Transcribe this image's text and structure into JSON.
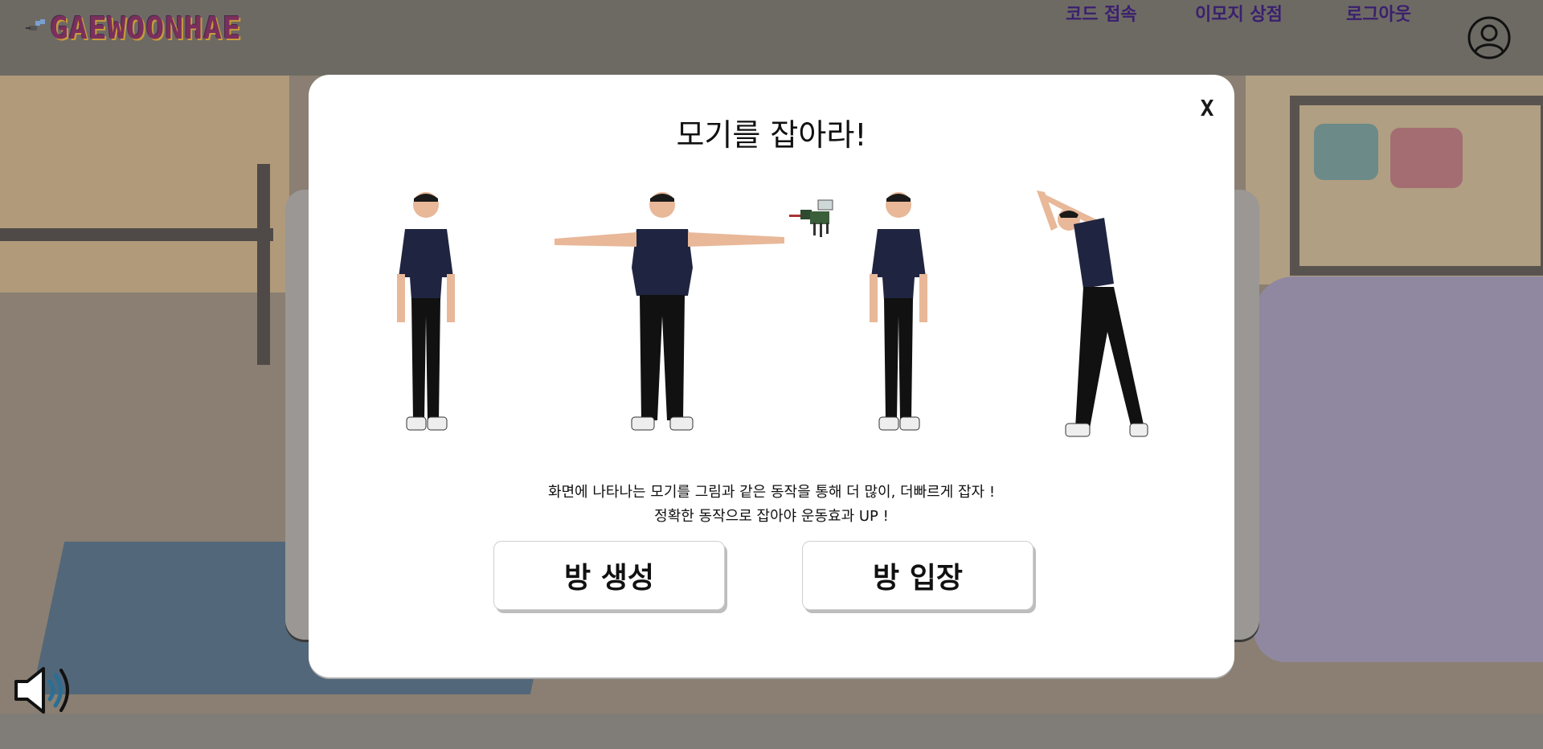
{
  "header": {
    "logo_text": "GAEWOONHAE",
    "nav": {
      "code_join": "코드 접속",
      "emoji_shop": "이모지 상점",
      "logout": "로그아웃"
    },
    "profile_icon": "user-circle-icon"
  },
  "modal": {
    "close_label": "X",
    "title": "모기를 잡아라!",
    "description_line1": "화면에 나타나는 모기를 그림과 같은 동작을 통해 더 많이, 더빠르게 잡자 !",
    "description_line2": "정확한 동작으로 잡아야 운동효과 UP !",
    "create_room_button": "방 생성",
    "join_room_button": "방 입장",
    "poses": [
      "standing",
      "arms-spread",
      "standing",
      "side-stretch"
    ],
    "mosquito_icon": "mosquito-icon"
  },
  "footer": {
    "sound_icon": "speaker-icon"
  },
  "colors": {
    "nav_text": "#3a1f6e",
    "logo": "#7a2f5c",
    "overlay": "#7a7570",
    "modal_bg": "#ffffff"
  }
}
